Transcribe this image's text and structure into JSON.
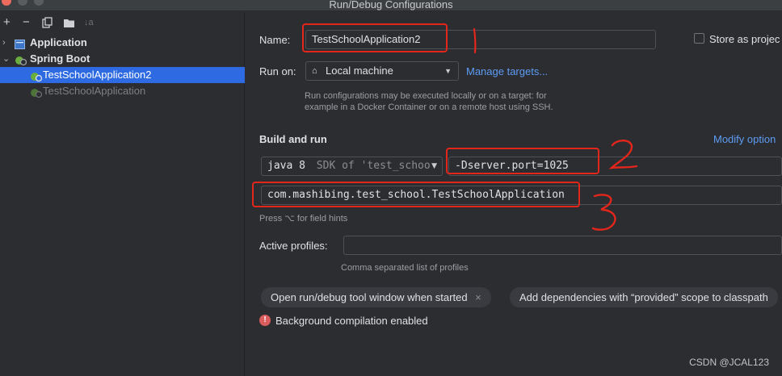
{
  "window": {
    "title": "Run/Debug Configurations"
  },
  "toolbar": {
    "add": "+",
    "remove": "−",
    "copy_icon": "copy-icon",
    "folder_icon": "folder-icon",
    "sort": "↓a"
  },
  "tree": {
    "application": "Application",
    "spring_boot": "Spring Boot",
    "items": [
      "TestSchoolApplication2",
      "TestSchoolApplication"
    ]
  },
  "form": {
    "name_label": "Name:",
    "name_value": "TestSchoolApplication2",
    "store_label": "Store as projec",
    "run_on_label": "Run on:",
    "run_on_value": "Local machine",
    "manage_targets": "Manage targets...",
    "run_on_hint": "Run configurations may be executed locally or on a target: for example in a Docker Container or on a remote host using SSH.",
    "build_run_label": "Build and run",
    "modify_options": "Modify option",
    "jdk_value": "java 8",
    "jdk_hint": "SDK of 'test_schoo",
    "vm_options": "-Dserver.port=1025",
    "main_class": "com.mashibing.test_school.TestSchoolApplication",
    "field_hints": "Press ⌥ for field hints",
    "active_profiles_label": "Active profiles:",
    "active_profiles_value": "",
    "profiles_hint": "Comma separated list of profiles",
    "chip1": "Open run/debug tool window when started",
    "chip1_close": "×",
    "chip2": "Add dependencies with “provided” scope to classpath",
    "warning": "Background compilation enabled"
  },
  "annotations": {
    "one": "1",
    "two": "2",
    "three": "3"
  },
  "watermark": "CSDN @JCAL123",
  "colors": {
    "accent": "#2e6ae2",
    "link": "#5e9cf5",
    "annotation": "#e3261b"
  }
}
